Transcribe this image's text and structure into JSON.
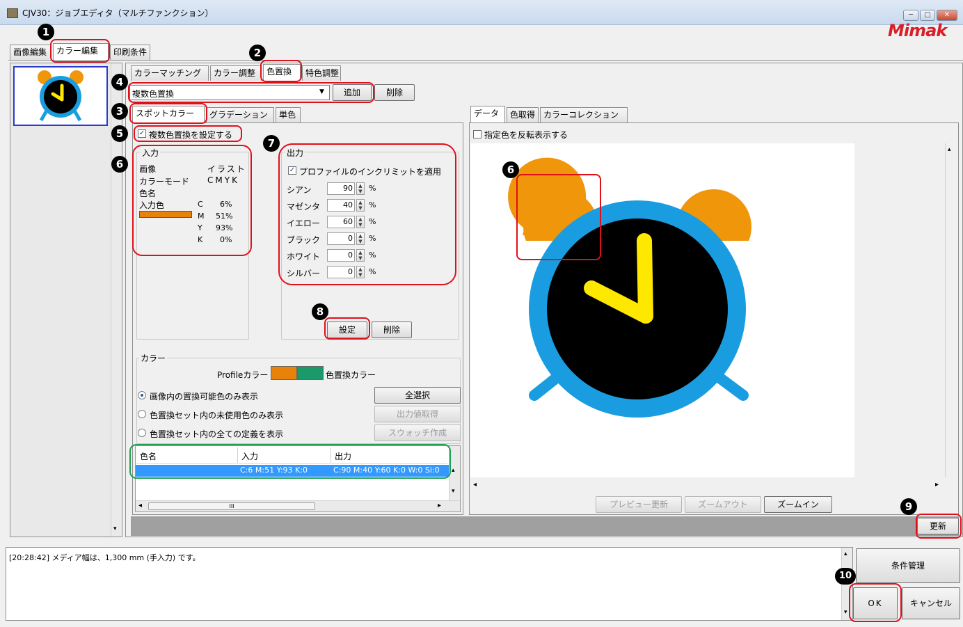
{
  "window": {
    "title": "CJV30：ジョブエディタ（マルチファンクション）",
    "logo": "Mimak",
    "minimize": "─",
    "maximize": "□",
    "close": "✕"
  },
  "main_tabs": [
    "画像編集",
    "カラー編集",
    "印刷条件"
  ],
  "sub_tabs": [
    "カラーマッチング",
    "カラー調整",
    "色置換",
    "特色調整"
  ],
  "replace_mode": {
    "selected": "複数色置換",
    "dropdown_arrow": "▼",
    "add_label": "追加",
    "delete_label": "削除"
  },
  "spot_tabs": [
    "スポットカラー",
    "グラデーション",
    "単色"
  ],
  "multi_replace_checkbox": "複数色置換を設定する",
  "input": {
    "legend": "入力",
    "rows": [
      {
        "label": "画像",
        "value": "イラスト"
      },
      {
        "label": "カラーモード",
        "value": "CMYK"
      }
    ],
    "color_name_label": "色名",
    "input_color_label": "入力色",
    "swatch_color": "#e8820a",
    "cmyk": [
      {
        "ch": "C",
        "val": "6%"
      },
      {
        "ch": "M",
        "val": "51%"
      },
      {
        "ch": "Y",
        "val": "93%"
      },
      {
        "ch": "K",
        "val": "0%"
      }
    ]
  },
  "output": {
    "legend": "出力",
    "inklimit_label": "プロファイルのインクリミットを適用",
    "unit": "%",
    "spin_up": "▲",
    "spin_down": "▼",
    "channels": [
      {
        "label": "シアン",
        "value": "90"
      },
      {
        "label": "マゼンタ",
        "value": "40"
      },
      {
        "label": "イエロー",
        "value": "60"
      },
      {
        "label": "ブラック",
        "value": "0"
      },
      {
        "label": "ホワイト",
        "value": "0"
      },
      {
        "label": "シルバー",
        "value": "0"
      }
    ],
    "set_label": "設定",
    "delete_label": "削除"
  },
  "color_section": {
    "legend": "カラー",
    "profile_label": "Profileカラー",
    "replace_label": "色置換カラー",
    "profile_swatch": "#e8820a",
    "replace_swatch": "#1a9a6a",
    "radios": [
      "画像内の置換可能色のみ表示",
      "色置換セット内の未使用色のみ表示",
      "色置換セット内の全ての定義を表示"
    ],
    "select_all": "全選択",
    "get_output": "出力値取得",
    "make_swatch": "スウォッチ作成"
  },
  "table": {
    "headers": [
      "色名",
      "入力",
      "出力"
    ],
    "rows": [
      {
        "name": "",
        "input": "C:6 M:51 Y:93 K:0",
        "output": "C:90 M:40 Y:60 K:0 W:0 Si:0"
      }
    ],
    "hscroll_thumb": "III",
    "arrow_left": "◂",
    "arrow_right": "▸",
    "arrow_up": "▴",
    "arrow_down": "▾"
  },
  "preview": {
    "tabs": [
      "データ",
      "色取得",
      "カラーコレクション"
    ],
    "invert_label": "指定色を反転表示する",
    "update_preview": "プレビュー更新",
    "zoom_out": "ズームアウト",
    "zoom_in": "ズームイン",
    "update": "更新",
    "clock_colors": {
      "bells": "#f0960a",
      "ring": "#1a9de0",
      "face": "#000000",
      "hands": "#ffe800"
    }
  },
  "log": {
    "message": "[20:28:42] メディア幅は、1,300 mm (手入力) です。"
  },
  "footer": {
    "manage": "条件管理",
    "ok": "OK",
    "cancel": "キャンセル"
  },
  "callouts": [
    "1",
    "2",
    "3",
    "4",
    "5",
    "6",
    "7",
    "8",
    "6",
    "9",
    "10"
  ]
}
